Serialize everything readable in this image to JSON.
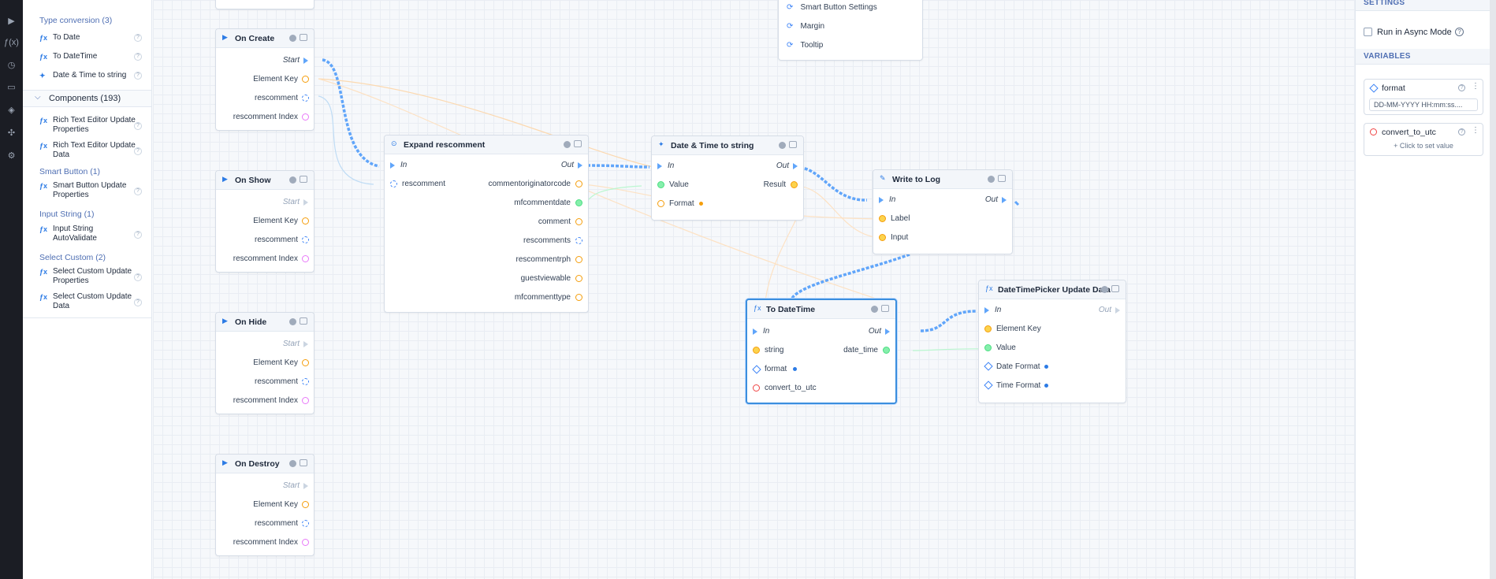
{
  "library": {
    "top_group": "",
    "type_conversion": {
      "label": "Type conversion (3)",
      "items": [
        "To Date",
        "To DateTime",
        "Date & Time to string"
      ]
    },
    "components_section": "Components (193)",
    "rich_items": [
      "Rich Text Editor Update Properties",
      "Rich Text Editor Update Data"
    ],
    "smart_button": {
      "label": "Smart Button (1)",
      "items": [
        "Smart Button Update Properties"
      ]
    },
    "input_string": {
      "label": "Input String (1)",
      "items": [
        "Input String AutoValidate"
      ]
    },
    "select_custom": {
      "label": "Select Custom (2)",
      "items": [
        "Select Custom Update Properties",
        "Select Custom Update Data"
      ]
    }
  },
  "canvas": {
    "smart_button_menu": [
      "Smart Button Settings",
      "Margin",
      "Tooltip"
    ],
    "events": [
      {
        "title": "On Create",
        "start": "Start",
        "pins": [
          "Element Key",
          "rescomment",
          "rescomment Index"
        ]
      },
      {
        "title": "On Show",
        "start": "Start",
        "pins": [
          "Element Key",
          "rescomment",
          "rescomment Index"
        ]
      },
      {
        "title": "On Hide",
        "start": "Start",
        "pins": [
          "Element Key",
          "rescomment",
          "rescomment Index"
        ]
      },
      {
        "title": "On Destroy",
        "start": "Start",
        "pins": [
          "Element Key",
          "rescomment",
          "rescomment Index"
        ]
      }
    ],
    "expand": {
      "title": "Expand rescomment",
      "in": "In",
      "out": "Out",
      "input": "rescomment",
      "outputs": [
        "commentoriginatorcode",
        "mfcommentdate",
        "comment",
        "rescomments",
        "rescommentrph",
        "guestviewable",
        "mfcommenttype"
      ]
    },
    "datetime_to_string": {
      "title": "Date & Time to string",
      "in": "In",
      "out": "Out",
      "value": "Value",
      "format": "Format",
      "result": "Result"
    },
    "write_to_log": {
      "title": "Write to Log",
      "in": "In",
      "out": "Out",
      "label": "Label",
      "input": "Input"
    },
    "to_datetime": {
      "title": "To DateTime",
      "in": "In",
      "out": "Out",
      "string": "string",
      "format": "format",
      "convert": "convert_to_utc",
      "date_time": "date_time"
    },
    "dtp_update": {
      "title": "DateTimePicker Update Data",
      "in": "In",
      "out": "Out",
      "pins": [
        "Element Key",
        "Value",
        "Date Format",
        "Time Format"
      ]
    }
  },
  "right_panel": {
    "settings_header": "SETTINGS",
    "async_label": "Run in Async Mode",
    "variables_header": "VARIABLES",
    "format_var": {
      "name": "format",
      "value": "DD-MM-YYYY HH:mm:ss...."
    },
    "convert_var": {
      "name": "convert_to_utc",
      "hint": "+ Click to set value"
    }
  },
  "colors": {
    "accent": "#3b8ede",
    "wire": "#60a5fa",
    "orange_pin": "#f59e0b",
    "pink_pin": "#e879f9"
  }
}
